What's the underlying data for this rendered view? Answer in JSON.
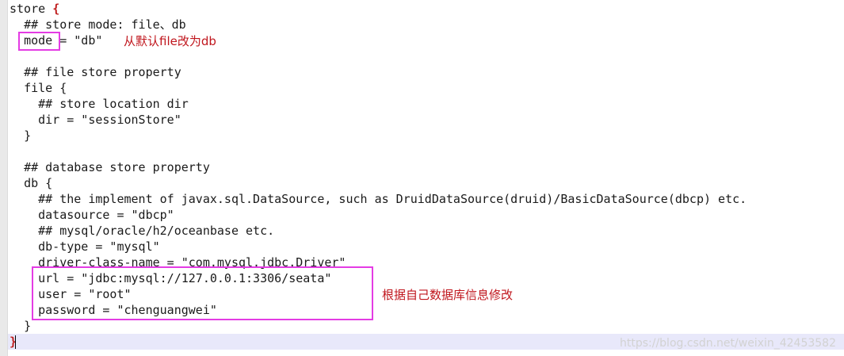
{
  "code_lines": [
    {
      "indent": "",
      "text": "store ",
      "brace": "{"
    },
    {
      "indent": "  ",
      "text": "## store mode: file、db"
    },
    {
      "indent": "  ",
      "text": "mode = \"db\""
    },
    {
      "indent": "",
      "text": ""
    },
    {
      "indent": "  ",
      "text": "## file store property"
    },
    {
      "indent": "  ",
      "text": "file {"
    },
    {
      "indent": "    ",
      "text": "## store location dir"
    },
    {
      "indent": "    ",
      "text": "dir = \"sessionStore\""
    },
    {
      "indent": "  ",
      "text": "}"
    },
    {
      "indent": "",
      "text": ""
    },
    {
      "indent": "  ",
      "text": "## database store property"
    },
    {
      "indent": "  ",
      "text": "db {"
    },
    {
      "indent": "    ",
      "text": "## the implement of javax.sql.DataSource, such as DruidDataSource(druid)/BasicDataSource(dbcp) etc."
    },
    {
      "indent": "    ",
      "text": "datasource = \"dbcp\""
    },
    {
      "indent": "    ",
      "text": "## mysql/oracle/h2/oceanbase etc."
    },
    {
      "indent": "    ",
      "text": "db-type = \"mysql\""
    },
    {
      "indent": "    ",
      "text": "driver-class-name = \"com.mysql.jdbc.Driver\""
    },
    {
      "indent": "    ",
      "text": "url = \"jdbc:mysql://127.0.0.1:3306/seata\""
    },
    {
      "indent": "    ",
      "text": "user = \"root\""
    },
    {
      "indent": "    ",
      "text": "password = \"chenguangwei\""
    },
    {
      "indent": "  ",
      "text": "}"
    },
    {
      "indent": "",
      "text": "",
      "brace": "}"
    }
  ],
  "annotations": {
    "mode_note": "从默认file改为db",
    "db_note": "根据自己数据库信息修改"
  },
  "watermark": "https://blog.csdn.net/weixin_42453582",
  "colors": {
    "annotation_box": "#e43ce4",
    "annotation_text": "#c0161d",
    "brace": "#c02020",
    "current_line": "#e8e8fa"
  }
}
